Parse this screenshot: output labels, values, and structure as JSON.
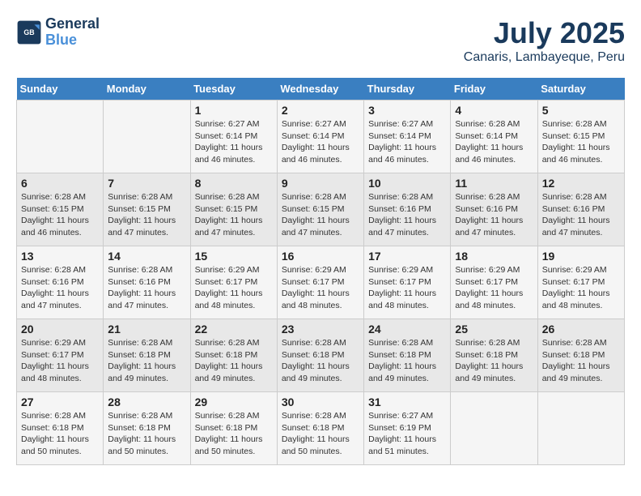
{
  "header": {
    "logo_line1": "General",
    "logo_line2": "Blue",
    "month": "July 2025",
    "location": "Canaris, Lambayeque, Peru"
  },
  "weekdays": [
    "Sunday",
    "Monday",
    "Tuesday",
    "Wednesday",
    "Thursday",
    "Friday",
    "Saturday"
  ],
  "weeks": [
    [
      {
        "day": "",
        "info": ""
      },
      {
        "day": "",
        "info": ""
      },
      {
        "day": "1",
        "info": "Sunrise: 6:27 AM\nSunset: 6:14 PM\nDaylight: 11 hours and 46 minutes."
      },
      {
        "day": "2",
        "info": "Sunrise: 6:27 AM\nSunset: 6:14 PM\nDaylight: 11 hours and 46 minutes."
      },
      {
        "day": "3",
        "info": "Sunrise: 6:27 AM\nSunset: 6:14 PM\nDaylight: 11 hours and 46 minutes."
      },
      {
        "day": "4",
        "info": "Sunrise: 6:28 AM\nSunset: 6:14 PM\nDaylight: 11 hours and 46 minutes."
      },
      {
        "day": "5",
        "info": "Sunrise: 6:28 AM\nSunset: 6:15 PM\nDaylight: 11 hours and 46 minutes."
      }
    ],
    [
      {
        "day": "6",
        "info": "Sunrise: 6:28 AM\nSunset: 6:15 PM\nDaylight: 11 hours and 46 minutes."
      },
      {
        "day": "7",
        "info": "Sunrise: 6:28 AM\nSunset: 6:15 PM\nDaylight: 11 hours and 47 minutes."
      },
      {
        "day": "8",
        "info": "Sunrise: 6:28 AM\nSunset: 6:15 PM\nDaylight: 11 hours and 47 minutes."
      },
      {
        "day": "9",
        "info": "Sunrise: 6:28 AM\nSunset: 6:15 PM\nDaylight: 11 hours and 47 minutes."
      },
      {
        "day": "10",
        "info": "Sunrise: 6:28 AM\nSunset: 6:16 PM\nDaylight: 11 hours and 47 minutes."
      },
      {
        "day": "11",
        "info": "Sunrise: 6:28 AM\nSunset: 6:16 PM\nDaylight: 11 hours and 47 minutes."
      },
      {
        "day": "12",
        "info": "Sunrise: 6:28 AM\nSunset: 6:16 PM\nDaylight: 11 hours and 47 minutes."
      }
    ],
    [
      {
        "day": "13",
        "info": "Sunrise: 6:28 AM\nSunset: 6:16 PM\nDaylight: 11 hours and 47 minutes."
      },
      {
        "day": "14",
        "info": "Sunrise: 6:28 AM\nSunset: 6:16 PM\nDaylight: 11 hours and 47 minutes."
      },
      {
        "day": "15",
        "info": "Sunrise: 6:29 AM\nSunset: 6:17 PM\nDaylight: 11 hours and 48 minutes."
      },
      {
        "day": "16",
        "info": "Sunrise: 6:29 AM\nSunset: 6:17 PM\nDaylight: 11 hours and 48 minutes."
      },
      {
        "day": "17",
        "info": "Sunrise: 6:29 AM\nSunset: 6:17 PM\nDaylight: 11 hours and 48 minutes."
      },
      {
        "day": "18",
        "info": "Sunrise: 6:29 AM\nSunset: 6:17 PM\nDaylight: 11 hours and 48 minutes."
      },
      {
        "day": "19",
        "info": "Sunrise: 6:29 AM\nSunset: 6:17 PM\nDaylight: 11 hours and 48 minutes."
      }
    ],
    [
      {
        "day": "20",
        "info": "Sunrise: 6:29 AM\nSunset: 6:17 PM\nDaylight: 11 hours and 48 minutes."
      },
      {
        "day": "21",
        "info": "Sunrise: 6:28 AM\nSunset: 6:18 PM\nDaylight: 11 hours and 49 minutes."
      },
      {
        "day": "22",
        "info": "Sunrise: 6:28 AM\nSunset: 6:18 PM\nDaylight: 11 hours and 49 minutes."
      },
      {
        "day": "23",
        "info": "Sunrise: 6:28 AM\nSunset: 6:18 PM\nDaylight: 11 hours and 49 minutes."
      },
      {
        "day": "24",
        "info": "Sunrise: 6:28 AM\nSunset: 6:18 PM\nDaylight: 11 hours and 49 minutes."
      },
      {
        "day": "25",
        "info": "Sunrise: 6:28 AM\nSunset: 6:18 PM\nDaylight: 11 hours and 49 minutes."
      },
      {
        "day": "26",
        "info": "Sunrise: 6:28 AM\nSunset: 6:18 PM\nDaylight: 11 hours and 49 minutes."
      }
    ],
    [
      {
        "day": "27",
        "info": "Sunrise: 6:28 AM\nSunset: 6:18 PM\nDaylight: 11 hours and 50 minutes."
      },
      {
        "day": "28",
        "info": "Sunrise: 6:28 AM\nSunset: 6:18 PM\nDaylight: 11 hours and 50 minutes."
      },
      {
        "day": "29",
        "info": "Sunrise: 6:28 AM\nSunset: 6:18 PM\nDaylight: 11 hours and 50 minutes."
      },
      {
        "day": "30",
        "info": "Sunrise: 6:28 AM\nSunset: 6:18 PM\nDaylight: 11 hours and 50 minutes."
      },
      {
        "day": "31",
        "info": "Sunrise: 6:27 AM\nSunset: 6:19 PM\nDaylight: 11 hours and 51 minutes."
      },
      {
        "day": "",
        "info": ""
      },
      {
        "day": "",
        "info": ""
      }
    ]
  ]
}
